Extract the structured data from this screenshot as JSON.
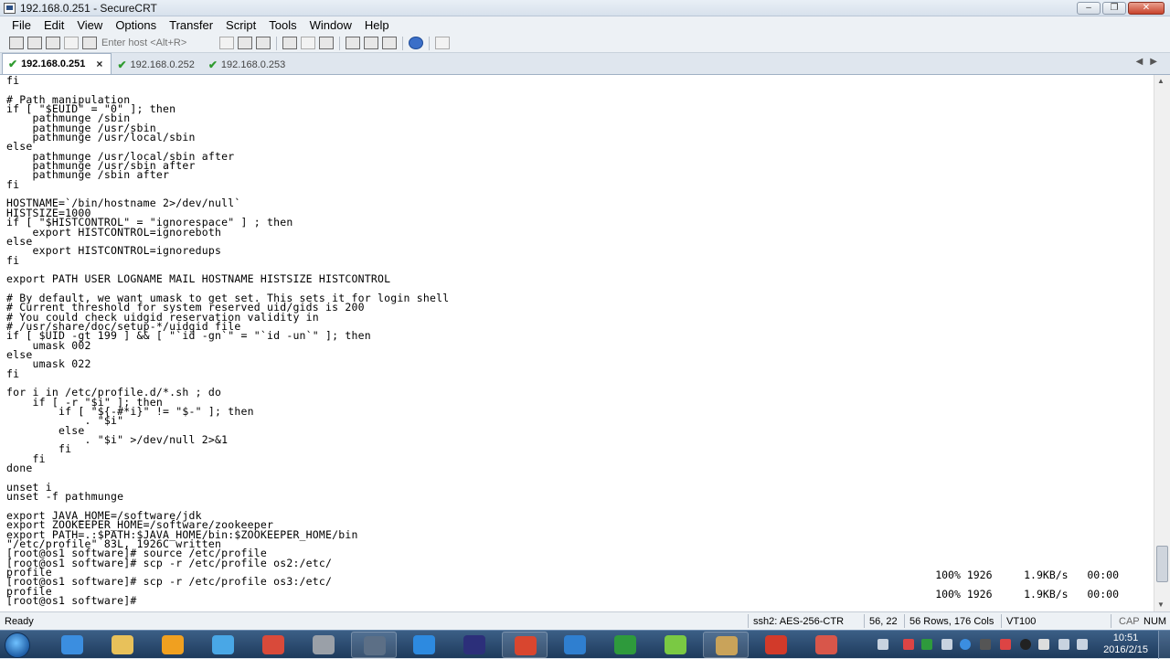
{
  "window": {
    "title": "192.168.0.251 - SecureCRT",
    "minimize_glyph": "–",
    "maximize_glyph": "❐",
    "close_glyph": "✕"
  },
  "menu": [
    "File",
    "Edit",
    "View",
    "Options",
    "Transfer",
    "Script",
    "Tools",
    "Window",
    "Help"
  ],
  "toolbar": {
    "quick_connect_placeholder": "Enter host <Alt+R>",
    "icons": [
      "connect-icon",
      "quick-connect-icon",
      "connect-in-tab-icon",
      "reconnect-icon",
      "disconnect-icon",
      "copy-icon",
      "paste-icon",
      "find-icon",
      "print-icon",
      "print-selection-icon",
      "print-setup-icon",
      "session-options-icon",
      "global-options-icon",
      "keymap-icon",
      "help-icon",
      "sftp-icon"
    ]
  },
  "tabs": [
    {
      "label": "192.168.0.251",
      "active": true,
      "status": "connected",
      "close_glyph": "×"
    },
    {
      "label": "192.168.0.252",
      "active": false,
      "status": "connected"
    },
    {
      "label": "192.168.0.253",
      "active": false,
      "status": "connected"
    }
  ],
  "tab_scroll": {
    "left": "◀",
    "right": "▶"
  },
  "terminal": {
    "lines": [
      "fi",
      "",
      "# Path manipulation",
      "if [ \"$EUID\" = \"0\" ]; then",
      "    pathmunge /sbin",
      "    pathmunge /usr/sbin",
      "    pathmunge /usr/local/sbin",
      "else",
      "    pathmunge /usr/local/sbin after",
      "    pathmunge /usr/sbin after",
      "    pathmunge /sbin after",
      "fi",
      "",
      "HOSTNAME=`/bin/hostname 2>/dev/null`",
      "HISTSIZE=1000",
      "if [ \"$HISTCONTROL\" = \"ignorespace\" ] ; then",
      "    export HISTCONTROL=ignoreboth",
      "else",
      "    export HISTCONTROL=ignoredups",
      "fi",
      "",
      "export PATH USER LOGNAME MAIL HOSTNAME HISTSIZE HISTCONTROL",
      "",
      "# By default, we want umask to get set. This sets it for login shell",
      "# Current threshold for system reserved uid/gids is 200",
      "# You could check uidgid reservation validity in",
      "# /usr/share/doc/setup-*/uidgid file",
      "if [ $UID -gt 199 ] && [ \"`id -gn`\" = \"`id -un`\" ]; then",
      "    umask 002",
      "else",
      "    umask 022",
      "fi",
      "",
      "for i in /etc/profile.d/*.sh ; do",
      "    if [ -r \"$i\" ]; then",
      "        if [ \"${-#*i}\" != \"$-\" ]; then",
      "            . \"$i\"",
      "        else",
      "            . \"$i\" >/dev/null 2>&1",
      "        fi",
      "    fi",
      "done",
      "",
      "unset i",
      "unset -f pathmunge",
      "",
      "export JAVA_HOME=/software/jdk",
      "export ZOOKEEPER_HOME=/software/zookeeper",
      "export PATH=.:$PATH:$JAVA_HOME/bin:$ZOOKEEPER_HOME/bin",
      "\"/etc/profile\" 83L, 1926C written",
      "[root@os1 software]# source /etc/profile",
      "[root@os1 software]# scp -r /etc/profile os2:/etc/",
      "profile",
      "[root@os1 software]# scp -r /etc/profile os3:/etc/",
      "profile",
      "[root@os1 software]# "
    ],
    "transfers": [
      "100% 1926     1.9KB/s   00:00",
      "100% 1926     1.9KB/s   00:00"
    ]
  },
  "status": {
    "state": "Ready",
    "cipher": "ssh2: AES-256-CTR",
    "cursor": "56, 22",
    "size": "56 Rows, 176 Cols",
    "emulation": "VT100",
    "caps": "CAP",
    "num": "NUM"
  },
  "taskbar": {
    "apps": [
      {
        "name": "internet-explorer-icon",
        "color": "#3b8ee0"
      },
      {
        "name": "file-explorer-icon",
        "color": "#e8c15a"
      },
      {
        "name": "media-player-icon",
        "color": "#f0a020"
      },
      {
        "name": "network-app-icon",
        "color": "#49a7e6"
      },
      {
        "name": "chrome-icon",
        "color": "#d94a3a"
      },
      {
        "name": "program-icon",
        "color": "#9aa0a8"
      },
      {
        "name": "securecrt-icon",
        "color": "#5c6f86"
      },
      {
        "name": "feather-app-icon",
        "color": "#2d8ae0"
      },
      {
        "name": "eclipse-icon",
        "color": "#2c2f7a"
      },
      {
        "name": "filezilla-icon",
        "color": "#d9462f"
      },
      {
        "name": "vmware-icon",
        "color": "#2f7fd0"
      },
      {
        "name": "project-icon",
        "color": "#2e9a3c"
      },
      {
        "name": "m-app-icon",
        "color": "#7ac943"
      },
      {
        "name": "folder-app-icon",
        "color": "#c9a35a"
      },
      {
        "name": "pdf-reader-icon",
        "color": "#d23a2a"
      },
      {
        "name": "drawing-app-icon",
        "color": "#d8564a"
      }
    ],
    "clock_time": "10:51",
    "clock_date": "2016/2/15"
  }
}
